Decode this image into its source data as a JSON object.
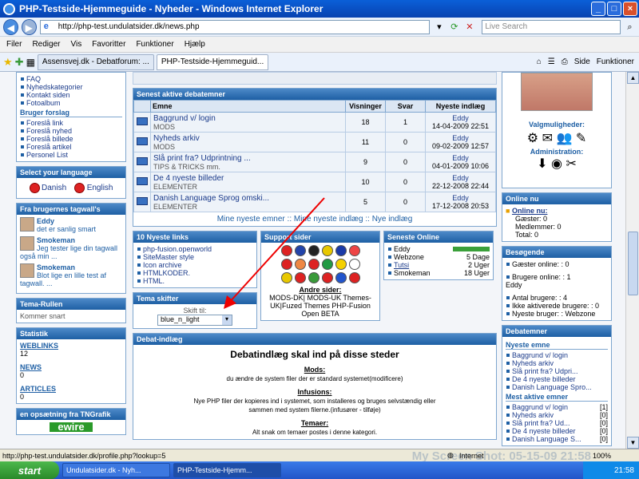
{
  "window": {
    "title": "PHP-Testside-Hjemmeguide - Nyheder - Windows Internet Explorer"
  },
  "address": {
    "url": "http://php-test.undulatsider.dk/news.php",
    "search_placeholder": "Live Search"
  },
  "menu": [
    "Filer",
    "Rediger",
    "Vis",
    "Favoritter",
    "Funktioner",
    "Hjælp"
  ],
  "tabs": [
    {
      "label": "Assensvej.dk - Debatforum: ..."
    },
    {
      "label": "PHP-Testside-Hjemmeguid..."
    }
  ],
  "tools": {
    "side": "Side",
    "funktioner": "Funktioner"
  },
  "left": {
    "nav_items": [
      "FAQ",
      "Nyhedskategorier",
      "Kontakt siden",
      "Fotoalbum"
    ],
    "bruger_forslag": "Bruger forslag",
    "forslag_items": [
      "Foreslå link",
      "Foreslå nyhed",
      "Foreslå billede",
      "Foreslå artikel",
      "Personel List"
    ],
    "lang_title": "Select your language",
    "lang": [
      "Danish",
      "English"
    ],
    "tag_title": "Fra brugernes tagwall's",
    "tags": [
      {
        "user": "Eddy",
        "msg": "det er sanlig smart"
      },
      {
        "user": "Smokeman",
        "msg": "Jeg tester lige din tagwall også min ..."
      },
      {
        "user": "Smokeman",
        "msg": "Blot lige en lille test af tagwall. ..."
      }
    ],
    "tema_title": "Tema-Rullen",
    "tema_text": "Kommer snart",
    "stat_title": "Statistik",
    "stats": [
      {
        "label": "WEBLINKS",
        "value": "12"
      },
      {
        "label": "NEWS",
        "value": "0"
      },
      {
        "label": "ARTICLES",
        "value": "0"
      }
    ],
    "tng_title": "en opsætning fra TNGrafik",
    "ewire": "ewire"
  },
  "center": {
    "forum_title": "Senest aktive debatemner",
    "cols": [
      "Emne",
      "Visninger",
      "Svar",
      "Nyeste indlæg"
    ],
    "threads": [
      {
        "title": "Baggrund v/ login",
        "cat": "MODS",
        "views": "18",
        "replies": "1",
        "user": "Eddy",
        "date": "14-04-2009 22:51"
      },
      {
        "title": "Nyheds arkiv",
        "cat": "MODS",
        "views": "11",
        "replies": "0",
        "user": "Eddy",
        "date": "09-02-2009 12:57"
      },
      {
        "title": "Slå print fra? Udprintning ...",
        "cat": "TIPS & TRICKS mm.",
        "views": "9",
        "replies": "0",
        "user": "Eddy",
        "date": "04-01-2009 10:06"
      },
      {
        "title": "De 4 nyeste billeder",
        "cat": "ELEMENTER",
        "views": "10",
        "replies": "0",
        "user": "Eddy",
        "date": "22-12-2008 22:44"
      },
      {
        "title": "Danish Language Sprog omski...",
        "cat": "ELEMENTER",
        "views": "5",
        "replies": "0",
        "user": "Eddy",
        "date": "17-12-2008 20:53"
      }
    ],
    "forum_links": "Mine nyeste emner :: Mine nyeste indlæg :: Nye indlæg",
    "links_title": "10 Nyeste links",
    "links": [
      "php-fusion.openworld",
      "SiteMaster style",
      "Icon archive",
      "HTMLKODER.",
      "HTML."
    ],
    "support_title": "Support sider",
    "andre": "Andre sider:",
    "andre_links": "MODS-DK| MODS-UK Themes-UK|Fuzed Themes PHP-Fusion Open BETA",
    "online_title": "Seneste Online",
    "online": [
      {
        "user": "Eddy",
        "time": ""
      },
      {
        "user": "Webzone",
        "time": "5 Dage"
      },
      {
        "user": "Tutsi",
        "time": "2 Uger"
      },
      {
        "user": "Smokeman",
        "time": "18 Uger"
      }
    ],
    "theme_title": "Tema skifter",
    "theme_label": "Skift til:",
    "theme_value": "blue_n_light",
    "debat_title": "Debat-indlæg",
    "debat_heading": "Debatindlæg skal ind på disse steder",
    "mods_h": "Mods:",
    "mods_t": "du ændre de system filer der er standard systemet(modificere)",
    "inf_h": "Infusions:",
    "inf_t": "Nye PHP filer der kopieres ind i systemet, som installeres og bruges selvstændig eller sammen med system filerne.(infusører - tilføje)",
    "tem_h": "Temaer:",
    "tem_t": "Alt snak om temaer postes i denne kategori."
  },
  "right": {
    "valg": "Valgmuligheder:",
    "admin": "Administration:",
    "online_title": "Online nu",
    "online_nu": "Online nu:",
    "gaester": "Gæster: 0",
    "medlemmer": "Medlemmer: 0",
    "total": "Total: 0",
    "besog_title": "Besøgende",
    "besog": [
      "Gæster online: : 0",
      "Brugere online: : 1",
      "Eddy",
      "Antal brugere: : 4",
      "Ikke aktiverede brugere: : 0",
      "Nyeste bruger: : Webzone"
    ],
    "debat_title": "Debatemner",
    "nyeste_emne": "Nyeste emne",
    "nyeste": [
      "Baggrund v/ login",
      "Nyheds arkiv",
      "Slå print fra? Udpri...",
      "De 4 nyeste billeder",
      "Danish Language Spro..."
    ],
    "mest_aktive": "Mest aktive emner",
    "mest": [
      {
        "t": "Baggrund v/ login",
        "n": "[1]"
      },
      {
        "t": "Nyheds arkiv",
        "n": "[0]"
      },
      {
        "t": "Slå print fra? Ud...",
        "n": "[0]"
      },
      {
        "t": "De 4 nyeste billeder",
        "n": "[0]"
      },
      {
        "t": "Danish Language S...",
        "n": "[0]"
      }
    ]
  },
  "status": {
    "text": "http://php-test.undulatsider.dk/profile.php?lookup=5",
    "zone": "Internet",
    "zoom": "100%",
    "watermark": "My Screen Shot: 05-15-09 21:58"
  },
  "taskbar": {
    "start": "start",
    "tasks": [
      "Undulatsider.dk - Nyh...",
      "PHP-Testside-Hjemm..."
    ],
    "clock": "21:58"
  }
}
